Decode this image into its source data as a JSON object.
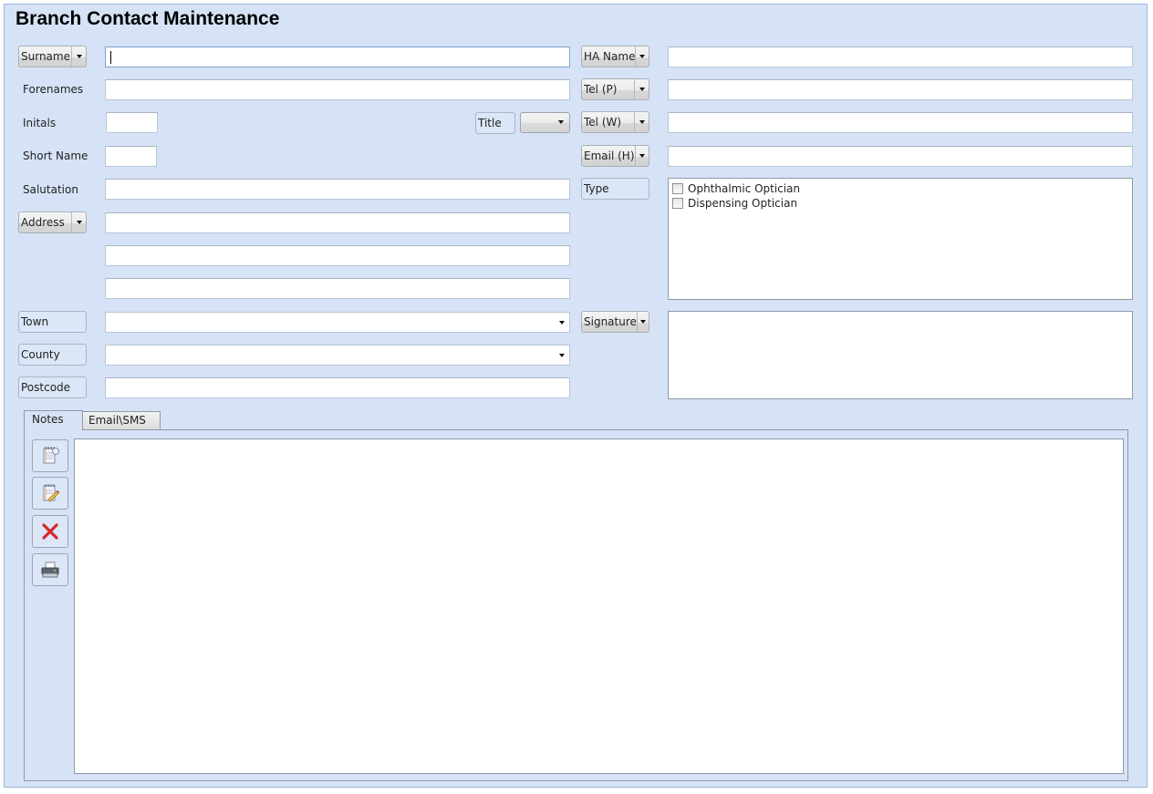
{
  "title": "Branch Contact Maintenance",
  "left": {
    "surname": {
      "label": "Surname",
      "value": ""
    },
    "forenames": {
      "label": "Forenames",
      "value": ""
    },
    "initials": {
      "label": "Initals",
      "value": ""
    },
    "title_field": {
      "label": "Title",
      "value": ""
    },
    "short_name": {
      "label": "Short Name",
      "value": ""
    },
    "salutation": {
      "label": "Salutation",
      "value": ""
    },
    "address": {
      "label": "Address",
      "lines": [
        "",
        "",
        ""
      ]
    },
    "town": {
      "label": "Town",
      "value": ""
    },
    "county": {
      "label": "County",
      "value": ""
    },
    "postcode": {
      "label": "Postcode",
      "value": ""
    }
  },
  "right": {
    "ha_name": {
      "label": "HA Name",
      "value": ""
    },
    "tel_p": {
      "label": "Tel (P)",
      "value": ""
    },
    "tel_w": {
      "label": "Tel (W)",
      "value": ""
    },
    "email_h": {
      "label": "Email (H)",
      "value": ""
    },
    "type": {
      "label": "Type",
      "options": [
        {
          "label": "Ophthalmic Optician",
          "checked": false
        },
        {
          "label": "Dispensing Optician",
          "checked": false
        }
      ]
    },
    "signature": {
      "label": "Signature",
      "value": ""
    }
  },
  "tabs": [
    {
      "label": "Notes",
      "active": true
    },
    {
      "label": "Email\\SMS",
      "active": false
    }
  ],
  "notes_toolbar": [
    {
      "name": "new-note",
      "icon": "new-note-icon"
    },
    {
      "name": "edit-note",
      "icon": "edit-note-icon"
    },
    {
      "name": "delete-note",
      "icon": "delete-icon"
    },
    {
      "name": "print-note",
      "icon": "printer-icon"
    }
  ],
  "notes": {
    "value": ""
  },
  "colors": {
    "background": "#d6e3f6",
    "border": "#8e9aa8",
    "delete_red": "#d9262c"
  }
}
